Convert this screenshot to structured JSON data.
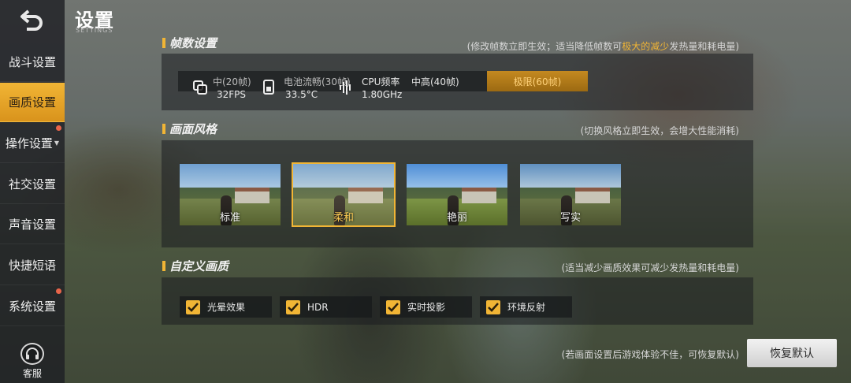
{
  "header": {
    "title": "设置",
    "subtitle": "SETTINGS"
  },
  "sidebar": {
    "items": [
      {
        "label": "战斗设置",
        "active": false,
        "dot": false
      },
      {
        "label": "画质设置",
        "active": true,
        "dot": false
      },
      {
        "label": "操作设置",
        "active": false,
        "dot": true,
        "caret": "▼"
      },
      {
        "label": "社交设置",
        "active": false,
        "dot": false
      },
      {
        "label": "声音设置",
        "active": false,
        "dot": false
      },
      {
        "label": "快捷短语",
        "active": false,
        "dot": false
      },
      {
        "label": "系统设置",
        "active": false,
        "dot": true
      }
    ],
    "service_label": "客服"
  },
  "fps_section": {
    "title": "帧数设置",
    "hint_prefix": "(修改帧数立即生效；适当降低帧数可",
    "hint_emphasis": "极大的减少",
    "hint_suffix": "发热量和耗电量)",
    "options": [
      "中(20帧)",
      "电池流畅(30帧)",
      "中高(40帧)",
      "极限(60帧)"
    ],
    "selected": "极限(60帧)",
    "overlay": {
      "fps_value": "32FPS",
      "battery_value": "33.5°C",
      "cpu_label": "CPU频率",
      "cpu_value": "1.80GHz"
    }
  },
  "style_section": {
    "title": "画面风格",
    "hint": "(切换风格立即生效，会增大性能消耗)",
    "styles": [
      {
        "label": "标准",
        "selected": false
      },
      {
        "label": "柔和",
        "selected": true
      },
      {
        "label": "艳丽",
        "selected": false
      },
      {
        "label": "写实",
        "selected": false
      }
    ]
  },
  "custom_section": {
    "title": "自定义画质",
    "hint": "(适当减少画质效果可减少发热量和耗电量)",
    "options": [
      {
        "label": "光晕效果",
        "checked": true
      },
      {
        "label": "HDR",
        "checked": true
      },
      {
        "label": "实时投影",
        "checked": true
      },
      {
        "label": "环境反射",
        "checked": true
      }
    ]
  },
  "footer": {
    "hint": "(若画面设置后游戏体验不佳，可恢复默认)",
    "restore_label": "恢复默认"
  },
  "colors": {
    "accent": "#f1b535",
    "sidebar_bg": "#1e2024",
    "dot": "#e9654a"
  }
}
